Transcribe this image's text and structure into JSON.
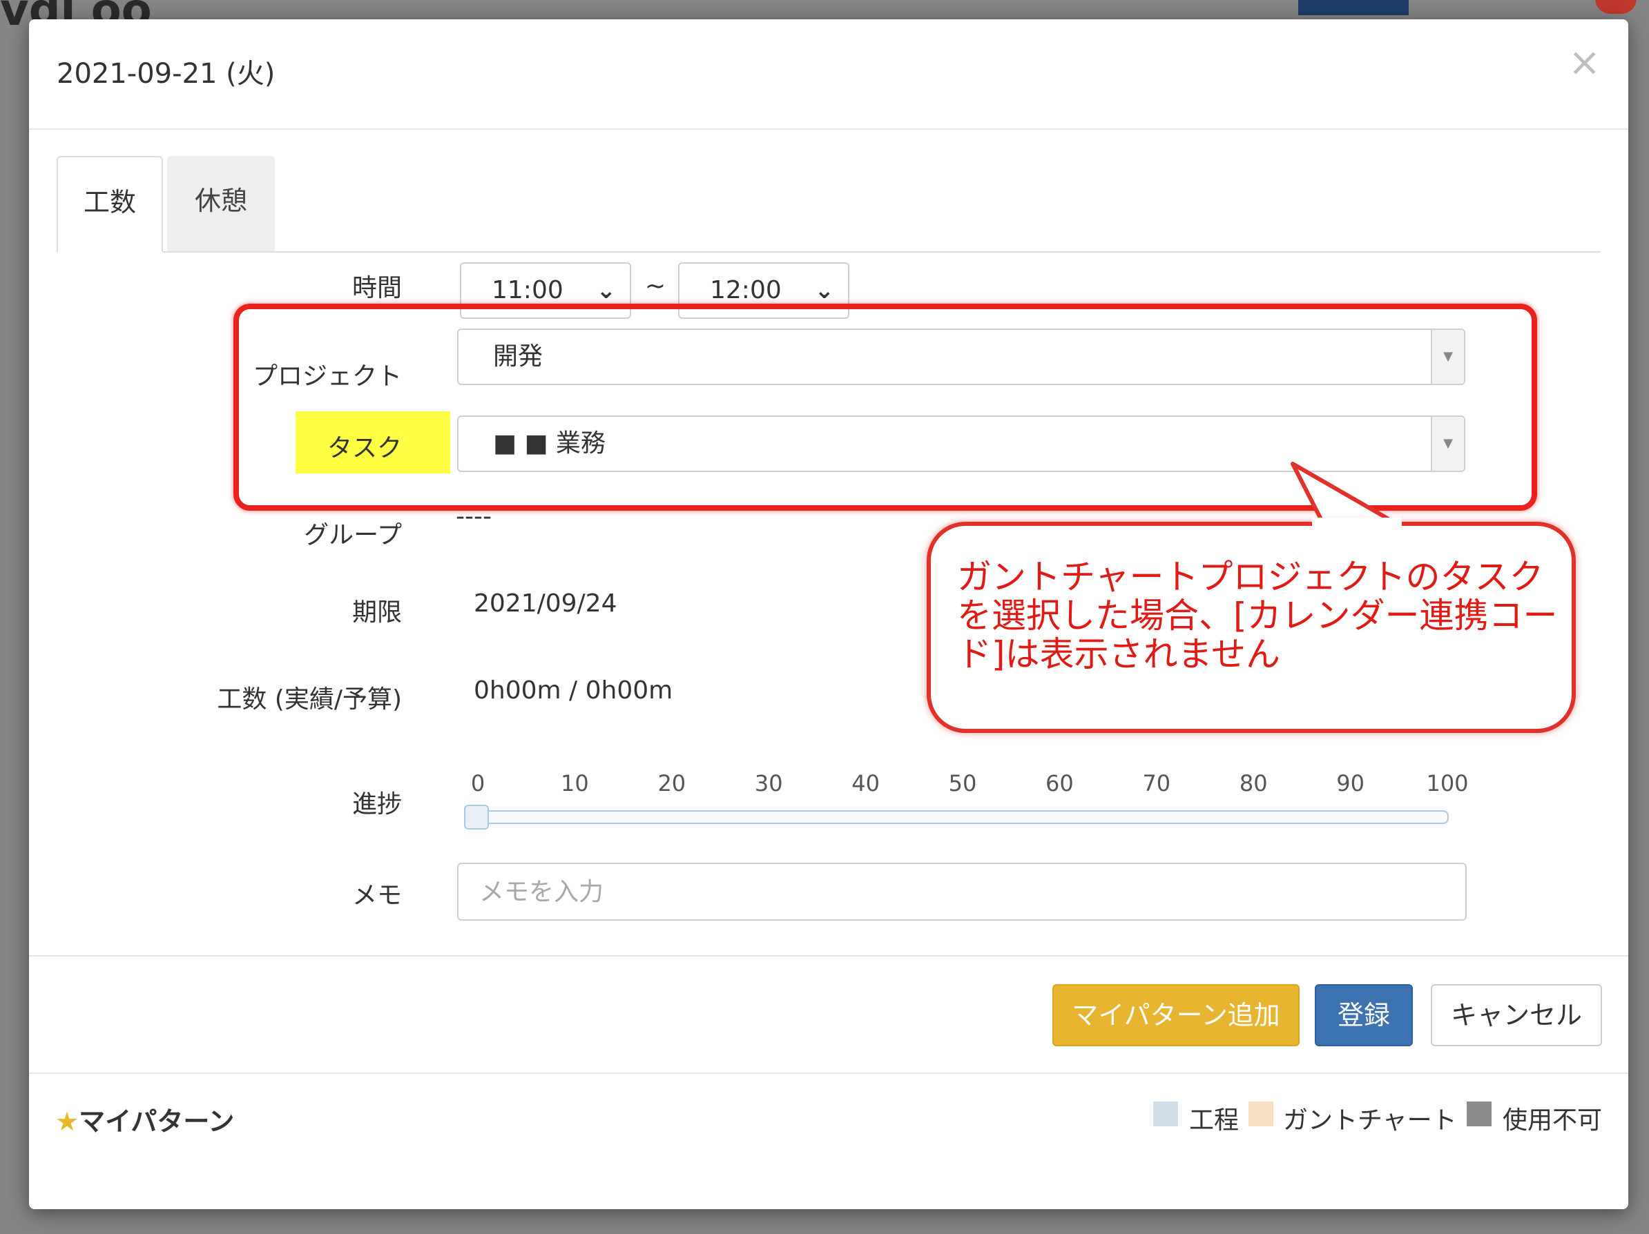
{
  "background": {
    "title_fragment": "vdl oo"
  },
  "modal": {
    "title": "2021-09-21 (火)",
    "close_icon": "close-icon"
  },
  "tabs": [
    {
      "label": "工数",
      "active": true
    },
    {
      "label": "休憩",
      "active": false
    }
  ],
  "form": {
    "time_label": "時間",
    "start_time": "11:00",
    "end_time": "12:00",
    "time_separator": "~",
    "project_label": "プロジェクト",
    "project_value": "開発",
    "task_label": "タスク",
    "task_value": "■ ■ 業務",
    "group_label": "グループ",
    "group_value": "----",
    "deadline_label": "期限",
    "deadline_value": "2021/09/24",
    "effort_label": "工数 (実績/予算)",
    "effort_value": "0h00m / 0h00m",
    "progress_label": "進捗",
    "progress_ticks": [
      "0",
      "10",
      "20",
      "30",
      "40",
      "50",
      "60",
      "70",
      "80",
      "90",
      "100"
    ],
    "progress_value": 0,
    "memo_label": "メモ",
    "memo_placeholder": "メモを入力"
  },
  "callout": {
    "text": "ガントチャートプロジェクトのタスクを選択した場合、[カレンダー連携コード]は表示されません",
    "color": "#e01a14"
  },
  "buttons": {
    "add_pattern": "マイパターン追加",
    "register": "登録",
    "cancel": "キャンセル"
  },
  "footer": {
    "my_pattern": "マイパターン",
    "legend": [
      {
        "label": "工程",
        "color": "#d3dfea"
      },
      {
        "label": "ガントチャート",
        "color": "#f8dfc0"
      },
      {
        "label": "使用不可",
        "color": "#8c8c8c"
      }
    ]
  },
  "colors": {
    "highlight_border": "#e8231f",
    "label_highlight": "#ffff44",
    "warn_button": "#e8b531",
    "primary_button": "#3d72b0"
  }
}
